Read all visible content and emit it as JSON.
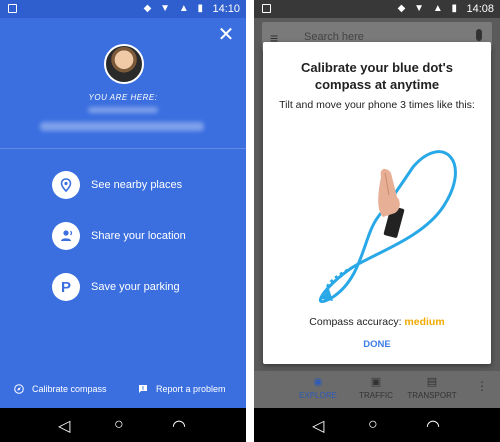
{
  "left_phone": {
    "status_bar": {
      "time": "14:10"
    },
    "you_are_here_label": "YOU ARE HERE:",
    "actions": [
      {
        "label": "See nearby places",
        "icon": "location-pin-icon"
      },
      {
        "label": "Share your location",
        "icon": "person-share-icon"
      },
      {
        "label": "Save your parking",
        "icon": "parking-icon"
      }
    ],
    "footer": {
      "calibrate": "Calibrate compass",
      "report": "Report a problem"
    },
    "colors": {
      "background": "#3b6fe0",
      "status_bar": "#2f5fcf"
    }
  },
  "right_phone": {
    "status_bar": {
      "time": "14:08"
    },
    "search_placeholder": "Search here",
    "dialog": {
      "title": "Calibrate your blue dot's compass at anytime",
      "instruction": "Tilt and move your phone 3 times like this:",
      "accuracy_label": "Compass accuracy:",
      "accuracy_value": "medium",
      "done_label": "DONE"
    },
    "bottom_tabs": [
      {
        "label": "EXPLORE",
        "icon": "explore-pin-icon"
      },
      {
        "label": "TRAFFIC",
        "icon": "car-icon"
      },
      {
        "label": "TRANSPORT",
        "icon": "bus-icon"
      }
    ],
    "colors": {
      "accent": "#3d7ee5",
      "accuracy": "#f2a900"
    }
  }
}
